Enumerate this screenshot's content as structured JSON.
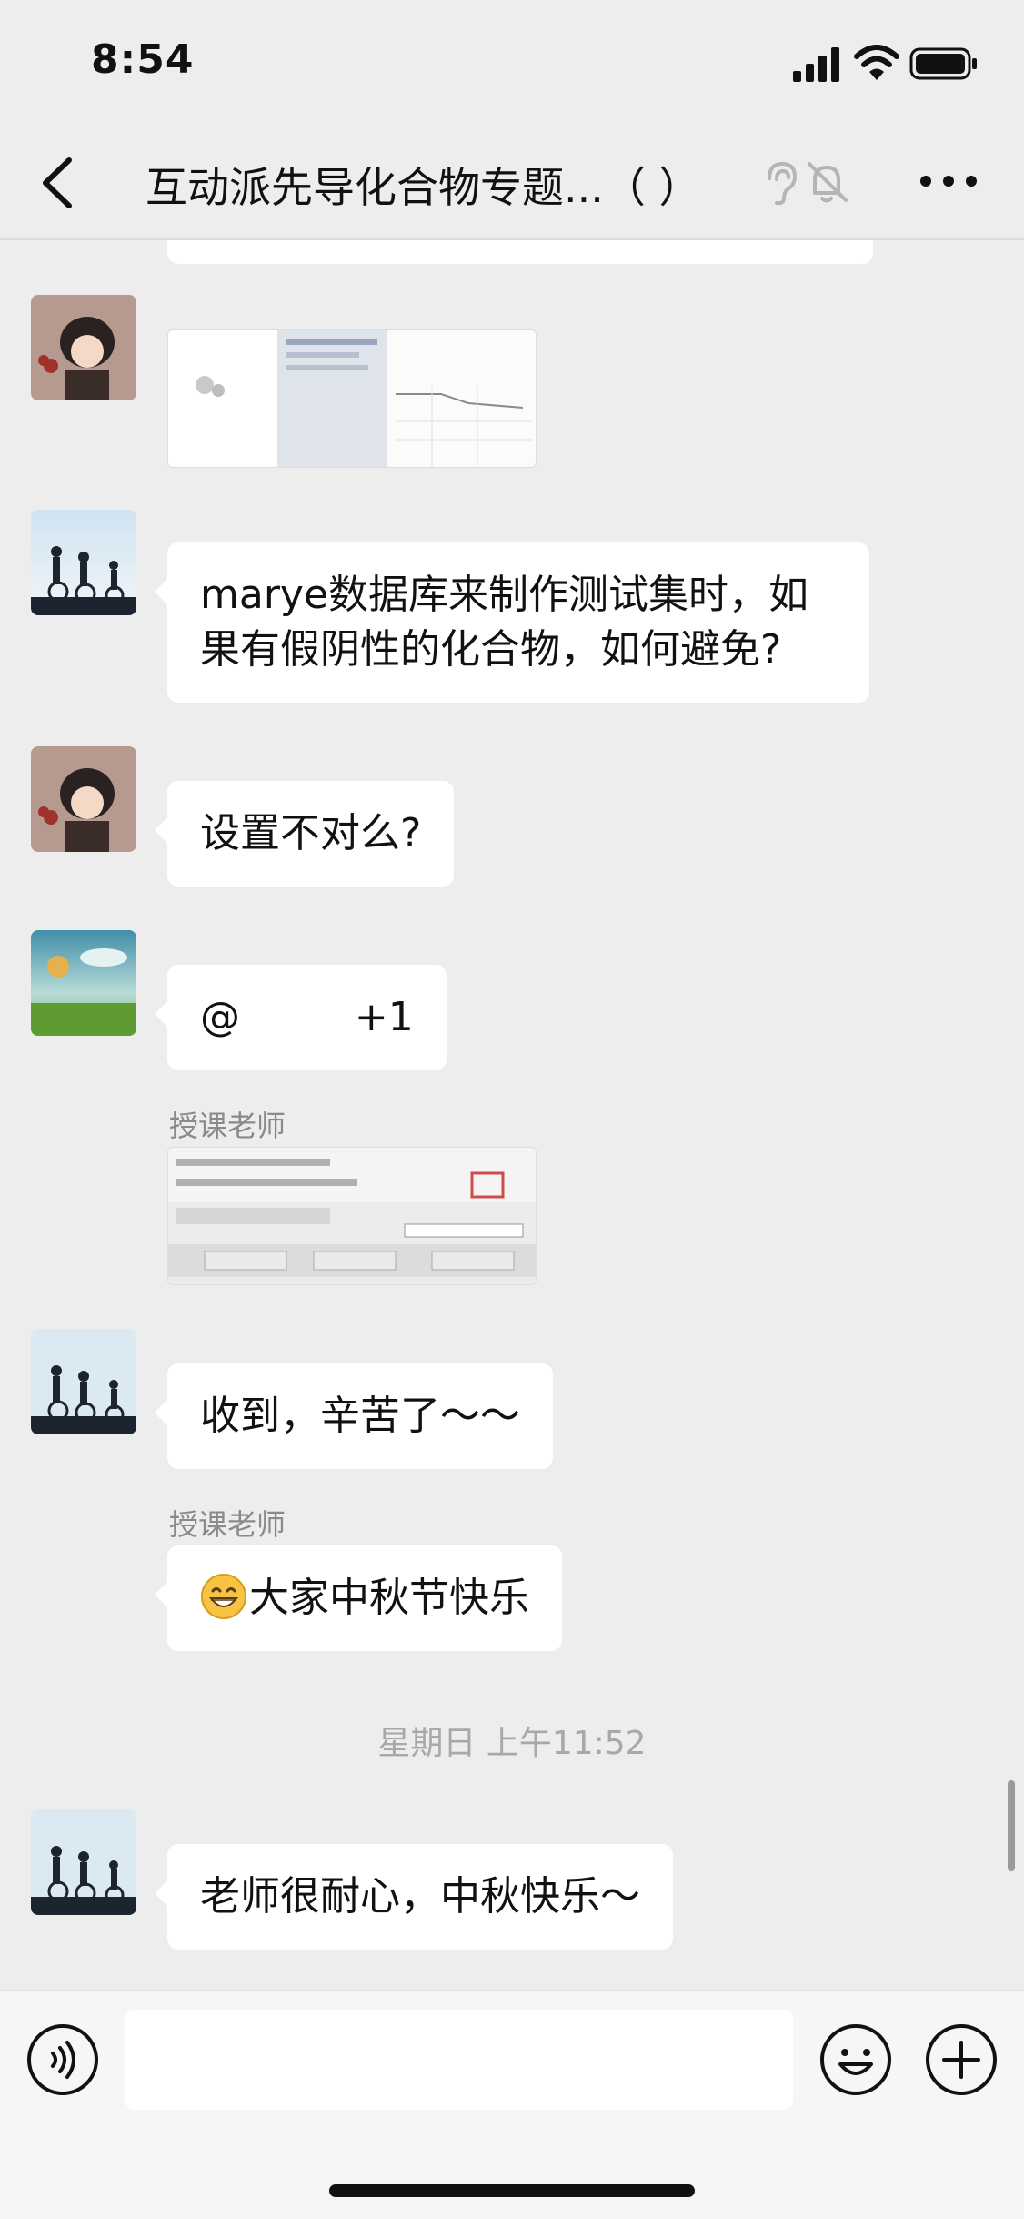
{
  "status_bar": {
    "time": "8:54"
  },
  "nav": {
    "title": "互动派先导化合物专题...（    ）"
  },
  "messages": [
    {
      "type": "text",
      "text": "marye数据库来制作测试集时，如果有假阴性的化合物，如何避免?"
    },
    {
      "type": "text",
      "text": "设置不对么?"
    },
    {
      "type": "text",
      "text": "@         +1"
    },
    {
      "type": "sender",
      "text": "授课老师"
    },
    {
      "type": "text",
      "text": "收到，辛苦了～～"
    },
    {
      "type": "sender",
      "text": "授课老师"
    },
    {
      "type": "text",
      "text": "大家中秋节快乐"
    },
    {
      "type": "text",
      "text": "老师很耐心，中秋快乐～"
    }
  ],
  "timestamp": "星期日 上午11:52",
  "colors": {
    "background": "#ededed",
    "bubble": "#ffffff",
    "input_bar": "#f6f6f6"
  },
  "icons": [
    "signal-icon",
    "wifi-icon",
    "battery-icon",
    "back-icon",
    "ear-icon",
    "mute-bell-icon",
    "more-icon",
    "voice-icon",
    "emoji-icon",
    "plus-icon"
  ]
}
